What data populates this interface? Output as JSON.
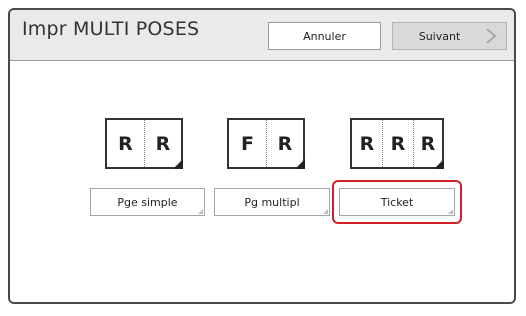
{
  "header": {
    "title": "Impr MULTI POSES",
    "cancel_label": "Annuler",
    "next_label": "Suivant"
  },
  "options": [
    {
      "label": "Pge simple",
      "icon_letters": [
        "R",
        "R"
      ],
      "icon_name": "two-panel-same-icon",
      "selected": false
    },
    {
      "label": "Pg multipl",
      "icon_letters": [
        "F",
        "R"
      ],
      "icon_name": "two-panel-front-back-icon",
      "selected": false
    },
    {
      "label": "Ticket",
      "icon_letters": [
        "R",
        "R",
        "R"
      ],
      "icon_name": "three-panel-ticket-icon",
      "selected": true
    }
  ],
  "colors": {
    "header_bg": "#eaeaea",
    "selection_ring": "#d0202a",
    "next_button_bg": "#d9d9d9"
  }
}
